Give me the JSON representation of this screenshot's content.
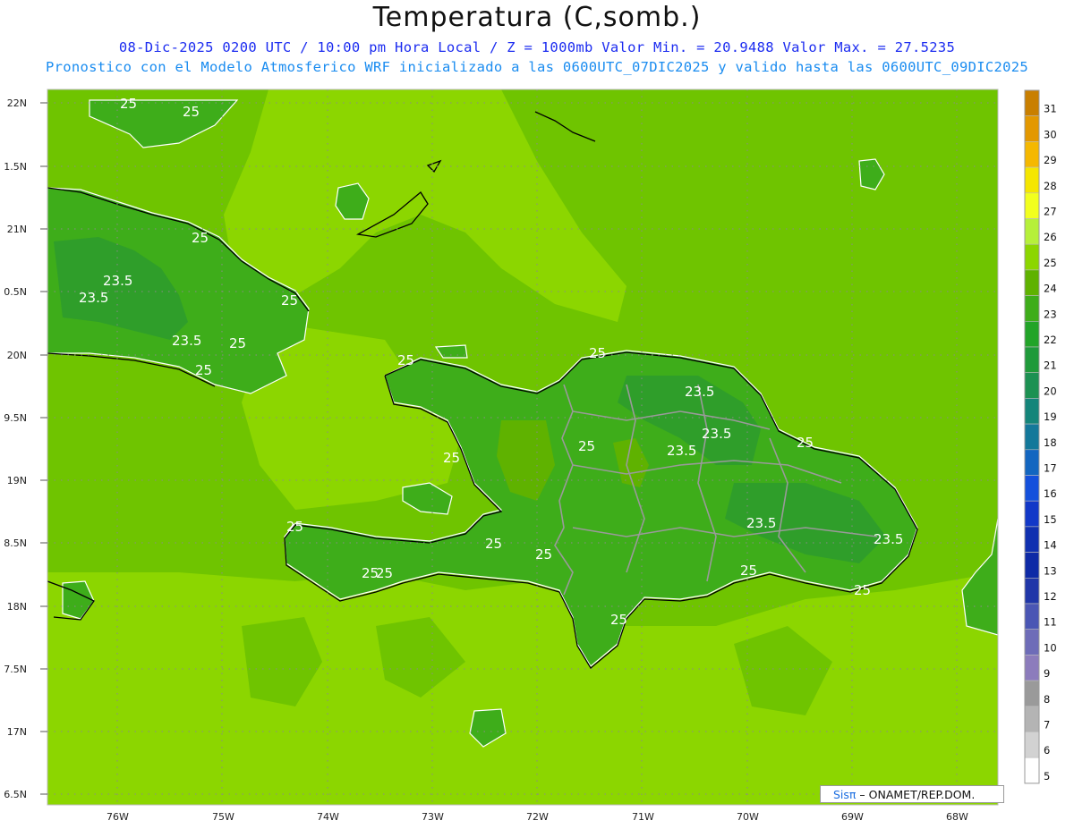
{
  "title": "Temperatura (C,somb.)",
  "subtitle_line1": "08-Dic-2025 0200 UTC / 10:00 pm Hora Local / Z = 1000mb  Valor Min. = 20.9488  Valor Max. = 27.5235",
  "subtitle_line2": "Pronostico con el Modelo Atmosferico WRF inicializado a las 0600UTC_07DIC2025 y valido hasta las  0600UTC_09DIC2025",
  "credit": {
    "brand": "Sisπ",
    "text": " – ONAMET/REP.DOM."
  },
  "longitude_ticks": [
    "76W",
    "75W",
    "74W",
    "73W",
    "72W",
    "71W",
    "70W",
    "69W",
    "68W"
  ],
  "latitude_ticks": [
    "22N",
    "1.5N",
    "21N",
    "0.5N",
    "20N",
    "9.5N",
    "19N",
    "8.5N",
    "18N",
    "7.5N",
    "17N",
    "6.5N"
  ],
  "colorbar": {
    "labels": [
      "31",
      "30",
      "29",
      "28",
      "27",
      "26",
      "25",
      "24",
      "23",
      "22",
      "21",
      "20",
      "19",
      "18",
      "17",
      "16",
      "15",
      "14",
      "13",
      "12",
      "11",
      "10",
      "9",
      "8",
      "7",
      "6",
      "5"
    ],
    "colors": [
      "#c97f00",
      "#e39800",
      "#f5b800",
      "#f5e600",
      "#f2ff1e",
      "#b6f03a",
      "#8cd600",
      "#5fb200",
      "#3ead1a",
      "#22a428",
      "#1f9a3a",
      "#1c9152",
      "#14857a",
      "#13789a",
      "#1366c0",
      "#1450dc",
      "#1238c8",
      "#1030b0",
      "#0e2aa6",
      "#2036a8",
      "#4a56b4",
      "#6e6cb8",
      "#8c7cbc",
      "#9a9a9a",
      "#b4b4b4",
      "#d2d2d2",
      "#ffffff"
    ]
  },
  "contour_labels": [
    "25",
    "25",
    "25",
    "23.5",
    "23.5",
    "25",
    "25",
    "23.5",
    "25",
    "25",
    "25",
    "23.5",
    "25",
    "23.5",
    "23.5",
    "25",
    "25",
    "25",
    "25",
    "23.5",
    "25",
    "23.5",
    "25",
    "25",
    "25",
    "25",
    "25"
  ],
  "colors": {
    "ocean": "#8cd600",
    "ocean_mid": "#6fc400",
    "land_warm": "#5fb200",
    "land_cool": "#3ead1a",
    "land_coolest": "#2f9e2a",
    "coastline": "#000000",
    "borders": "#9a9a9a",
    "contour": "#ffffff",
    "grid": "#8a8a8a"
  }
}
